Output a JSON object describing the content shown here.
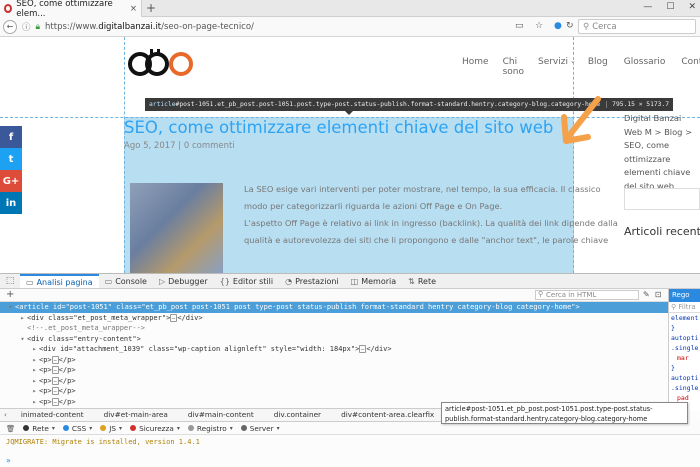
{
  "browser": {
    "tab_title": "SEO, come ottimizzare elem...",
    "tab_close": "×",
    "new_tab": "+",
    "url_prefix": "https://www.",
    "url_host": "digitalbanzai.it",
    "url_path": "/seo-on-page-tecnico/",
    "search_placeholder": "Cerca"
  },
  "site": {
    "nav": [
      "Home",
      "Chi sono",
      "Servizi",
      "Blog",
      "Glossario",
      "Contatti"
    ],
    "post_title": "SEO, come ottimizzare elementi chiave del sito web",
    "post_date": "Ago 5, 2017",
    "post_sep": " | ",
    "post_comments": "0 commenti",
    "body_lines": [
      "La SEO esige vari interventi per poter mostrare, nel tempo, la sua efficacia. Il classico",
      "modo per categorizzarli riguarda le azioni Off Page e On Page.",
      "L'aspetto Off Page è relativo ai link in ingresso (backlink). La qualità dei link dipende dalla",
      "qualità e autorevolezza dei siti che li propongono e dalle \"anchor text\", le parole chiave"
    ],
    "breadcrumb_right": "Digital Banzai Web M > Blog > SEO, come ottimizzare elementi chiave del sito web",
    "sidebar_heading": "Articoli recenti",
    "social": [
      "f",
      "t",
      "G+",
      "in"
    ]
  },
  "inspector_tooltip": {
    "tag": "article",
    "selector": "#post-1051.et_pb_post.post-1051.post.type-post.status-publish.format-standard.hentry.category-blog.category-home",
    "dims": "795.15 × 5173.7"
  },
  "devtools": {
    "tabs": [
      {
        "icon": "▭",
        "label": "Analisi pagina"
      },
      {
        "icon": "▭",
        "label": "Console"
      },
      {
        "icon": "▷",
        "label": "Debugger"
      },
      {
        "icon": "{}",
        "label": "Editor stili"
      },
      {
        "icon": "◔",
        "label": "Prestazioni"
      },
      {
        "icon": "◫",
        "label": "Memoria"
      },
      {
        "icon": "⇅",
        "label": "Rete"
      }
    ],
    "search_html": "Cerca in HTML",
    "rules_header": "Rego",
    "rules_filter": "Filtra",
    "rules_lines": [
      "element",
      "}",
      "autopti",
      ".single",
      "mar",
      "}",
      "autopti",
      ".single",
      "pad",
      "}"
    ],
    "tree": [
      {
        "indent": 0,
        "text_parts": [
          "<article id=\"post-1051\" class=\"et_pb_post post-1051 post type-post status-publish format-standard hentry category-blog category-home\">"
        ],
        "selected": true
      },
      {
        "indent": 1,
        "text_parts": [
          "<div class=\"et_post_meta_wrapper\">",
          "</div>"
        ],
        "selected": false
      },
      {
        "indent": 1,
        "text_parts": [
          "<!--.et_post_meta_wrapper-->"
        ],
        "selected": false
      },
      {
        "indent": 1,
        "text_parts": [
          "<div class=\"entry-content\">"
        ],
        "selected": false
      },
      {
        "indent": 2,
        "text_parts": [
          "<div id=\"attachment_1039\" class=\"wp-caption alignleft\" style=\"width: 184px\">",
          "</div>"
        ],
        "selected": false
      },
      {
        "indent": 2,
        "text_parts": [
          "<p>",
          "</p>"
        ],
        "selected": false
      },
      {
        "indent": 2,
        "text_parts": [
          "<p>",
          "</p>"
        ],
        "selected": false
      },
      {
        "indent": 2,
        "text_parts": [
          "<p>",
          "</p>"
        ],
        "selected": false
      },
      {
        "indent": 2,
        "text_parts": [
          "<p>",
          "</p>"
        ],
        "selected": false
      },
      {
        "indent": 2,
        "text_parts": [
          "<p>",
          "</p>"
        ],
        "selected": false
      },
      {
        "indent": 2,
        "text_parts": [
          "<p>",
          "</p>"
        ],
        "selected": false
      },
      {
        "indent": 2,
        "text_parts": [
          "<p>",
          "</p>"
        ],
        "selected": false
      }
    ],
    "breadcrumbs": [
      {
        "label": "inimated-content",
        "active": false
      },
      {
        "label": "div#et-main-area",
        "active": false
      },
      {
        "label": "div#main-content",
        "active": false
      },
      {
        "label": "div.container",
        "active": false
      },
      {
        "label": "div#content-area.clearfix",
        "active": false
      },
      {
        "label": "div#left-area",
        "active": false
      },
      {
        "label": "article#post-1051.et_pb_post.post-1051.p...",
        "active": true
      },
      {
        "label": "div.entry-content",
        "active": false
      },
      {
        "label": "p",
        "active": false
      }
    ],
    "console_filters": [
      {
        "label": "Rete",
        "color": "#333"
      },
      {
        "label": "CSS",
        "color": "#2b8ae0"
      },
      {
        "label": "JS",
        "color": "#e0a020"
      },
      {
        "label": "Sicurezza",
        "color": "#d03030"
      },
      {
        "label": "Registro",
        "color": "#999"
      },
      {
        "label": "Server",
        "color": "#666"
      }
    ],
    "console_message": "JQMIGRATE: Migrate is installed, version 1.4.1",
    "console_prompt": "»",
    "selector_tooltip": "article#post-1051.et_pb_post.post-1051.post.type-post.status-publish.format-standard.hentry.category-blog.category-home"
  },
  "colors": {
    "link_blue": "#2ea3f2",
    "highlight": "#b4dcf1",
    "facebook": "#3b5998",
    "twitter": "#1da1f2",
    "google": "#dd4b39",
    "linkedin": "#0077b5",
    "arrow_orange": "#f5a14a",
    "logo_orange": "#e8692c"
  }
}
